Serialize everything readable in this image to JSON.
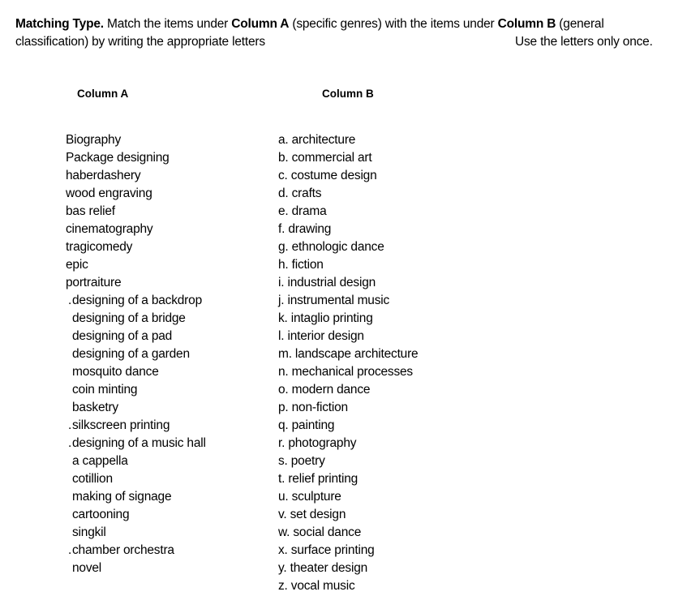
{
  "instructions": {
    "bold_lead": "Matching Type.",
    "text_1": " Match the items under ",
    "col_a_ref": "Column A",
    "text_2": " (specific genres) with the items under ",
    "col_b_ref": "Column B",
    "text_3": " (general",
    "line2": "classification) by writing the appropriate  letters",
    "note": "Use the letters only once."
  },
  "column_a": {
    "header": "Column A",
    "items": [
      {
        "text": "Biography",
        "indent": false,
        "dot": false
      },
      {
        "text": "Package designing",
        "indent": false,
        "dot": false
      },
      {
        "text": "haberdashery",
        "indent": false,
        "dot": false
      },
      {
        "text": "wood engraving",
        "indent": false,
        "dot": false
      },
      {
        "text": "bas relief",
        "indent": false,
        "dot": false
      },
      {
        "text": "cinematography",
        "indent": false,
        "dot": false
      },
      {
        "text": "tragicomedy",
        "indent": false,
        "dot": false
      },
      {
        "text": "epic",
        "indent": false,
        "dot": false
      },
      {
        "text": "portraiture",
        "indent": false,
        "dot": false
      },
      {
        "text": "designing of a backdrop",
        "indent": true,
        "dot": true
      },
      {
        "text": "designing of a bridge",
        "indent": true,
        "dot": false
      },
      {
        "text": "designing of a pad",
        "indent": true,
        "dot": false
      },
      {
        "text": "designing of a garden",
        "indent": true,
        "dot": false
      },
      {
        "text": "mosquito dance",
        "indent": true,
        "dot": false
      },
      {
        "text": "coin minting",
        "indent": true,
        "dot": false
      },
      {
        "text": "basketry",
        "indent": true,
        "dot": false
      },
      {
        "text": "silkscreen printing",
        "indent": true,
        "dot": true
      },
      {
        "text": "designing of a music hall",
        "indent": true,
        "dot": true
      },
      {
        "text": "a cappella",
        "indent": true,
        "dot": false
      },
      {
        "text": "cotillion",
        "indent": true,
        "dot": false
      },
      {
        "text": "making of signage",
        "indent": true,
        "dot": false
      },
      {
        "text": "cartooning",
        "indent": true,
        "dot": false
      },
      {
        "text": "singkil",
        "indent": true,
        "dot": false
      },
      {
        "text": "chamber orchestra",
        "indent": true,
        "dot": true
      },
      {
        "text": "novel",
        "indent": true,
        "dot": false
      }
    ]
  },
  "column_b": {
    "header": "Column B",
    "items": [
      "a. architecture",
      "b. commercial art",
      "c. costume design",
      "d. crafts",
      "e. drama",
      "f. drawing",
      "g. ethnologic dance",
      "h. fiction",
      "i. industrial design",
      "j. instrumental music",
      "k. intaglio printing",
      "l. interior design",
      "m. landscape architecture",
      "n. mechanical processes",
      "o. modern dance",
      "p. non-fiction",
      "q. painting",
      "r. photography",
      "s. poetry",
      "t. relief printing",
      "u. sculpture",
      "v. set design",
      "w. social dance",
      "x. surface printing",
      "y. theater design",
      "z. vocal music"
    ]
  },
  "dot_glyph": "."
}
